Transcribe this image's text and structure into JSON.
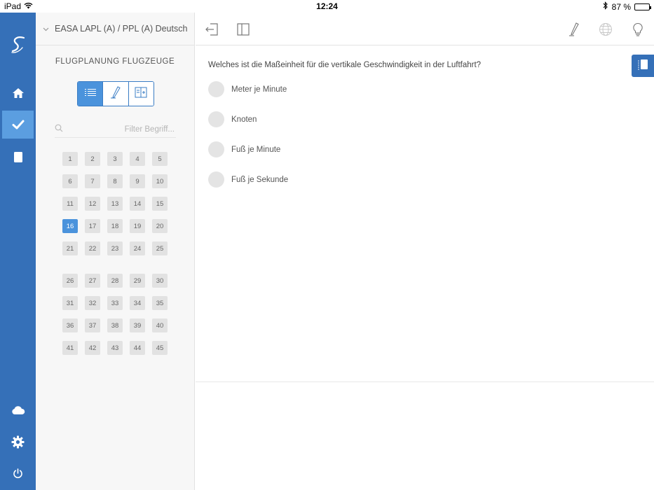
{
  "status": {
    "device": "iPad",
    "time": "12:24",
    "battery": "87 %",
    "battery_level": 0.87
  },
  "sidebar": {
    "course": "EASA LAPL (A) / PPL (A) Deutsch",
    "section_title": "FLUGPLANUNG FLUGZEUGE",
    "filter_placeholder": "Filter Begriff...",
    "questions": [
      "1",
      "2",
      "3",
      "4",
      "5",
      "6",
      "7",
      "8",
      "9",
      "10",
      "11",
      "12",
      "13",
      "14",
      "15",
      "16",
      "17",
      "18",
      "19",
      "20",
      "21",
      "22",
      "23",
      "24",
      "25",
      "26",
      "27",
      "28",
      "29",
      "30",
      "31",
      "32",
      "33",
      "34",
      "35",
      "36",
      "37",
      "38",
      "39",
      "40",
      "41",
      "42",
      "43",
      "44",
      "45"
    ],
    "active_question": "16"
  },
  "main": {
    "question": "Welches ist die Maßeinheit für die vertikale Geschwindigkeit in der Luftfahrt?",
    "answers": [
      "Meter je Minute",
      "Knoten",
      "Fuß je Minute",
      "Fuß je Sekunde"
    ]
  },
  "colors": {
    "rail": "#3570b8",
    "accent": "#4b93dc"
  }
}
